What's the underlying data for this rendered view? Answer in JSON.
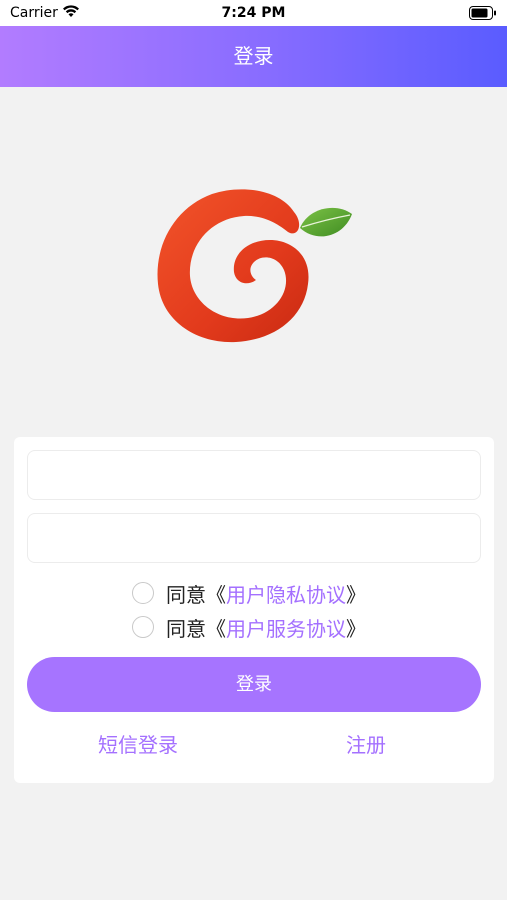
{
  "status_bar": {
    "carrier": "Carrier",
    "time": "7:24 PM"
  },
  "nav": {
    "title": "登录"
  },
  "logo": {
    "icon": "swirl-g-logo",
    "colors": {
      "swirl": "#e8391b",
      "leaf": "#5aa62b"
    }
  },
  "form": {
    "username_value": "",
    "password_value": ""
  },
  "agreements": [
    {
      "prefix": "同意",
      "open": "《",
      "link": "用户隐私协议",
      "close": "》"
    },
    {
      "prefix": "同意",
      "open": "《",
      "link": "用户服务协议",
      "close": "》"
    }
  ],
  "login_button": "登录",
  "links": {
    "sms_login": "短信登录",
    "register": "注册"
  },
  "colors": {
    "accent": "#a674ff",
    "nav_gradient_start": "#b27cff",
    "nav_gradient_end": "#5a5cff",
    "background": "#f2f2f2"
  }
}
